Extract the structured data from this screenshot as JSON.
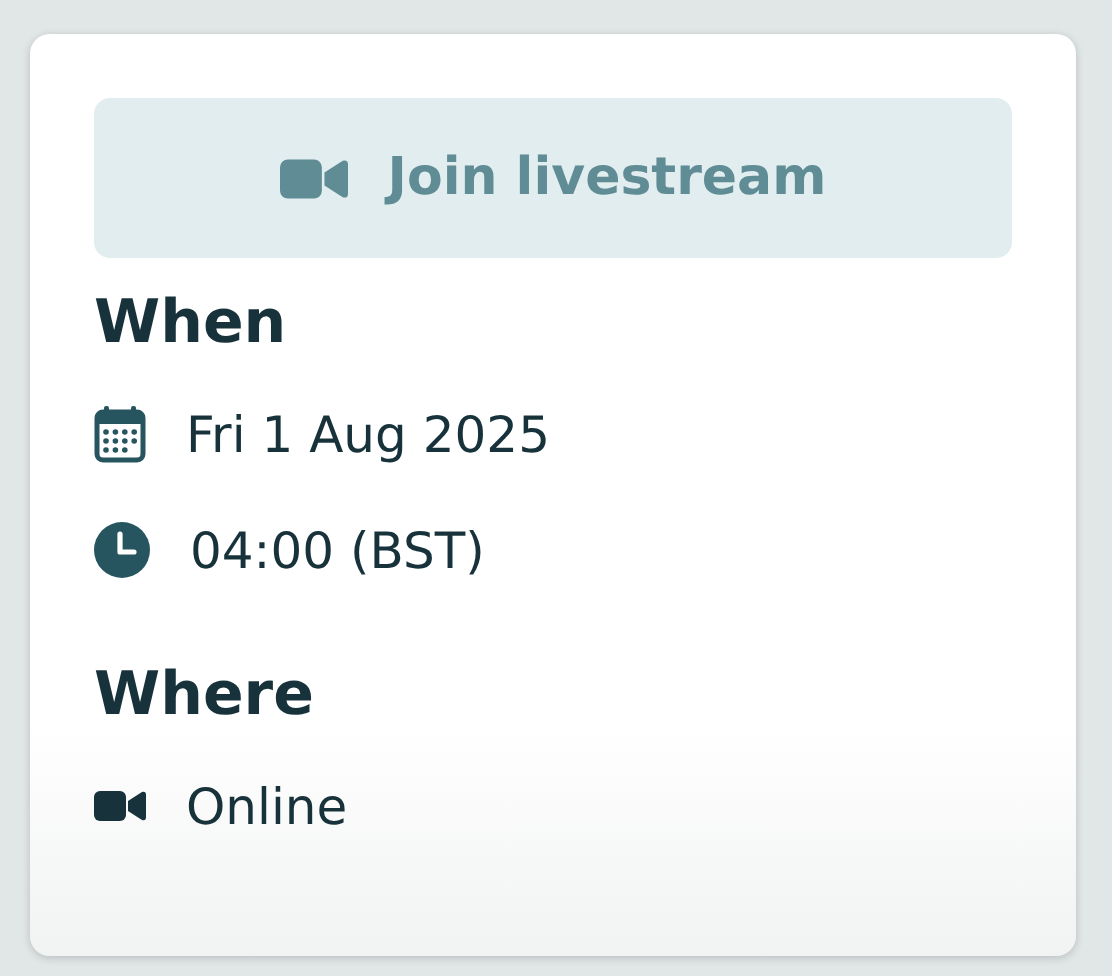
{
  "join_button": {
    "label": "Join livestream",
    "disabled": true
  },
  "when": {
    "heading": "When",
    "items": [
      {
        "kind": "calendar",
        "text": "Fri 1 Aug 2025"
      },
      {
        "kind": "clock",
        "text": "04:00 (BST)"
      }
    ]
  },
  "where": {
    "heading": "Where",
    "items": [
      {
        "kind": "video",
        "text": "Online"
      }
    ]
  }
}
